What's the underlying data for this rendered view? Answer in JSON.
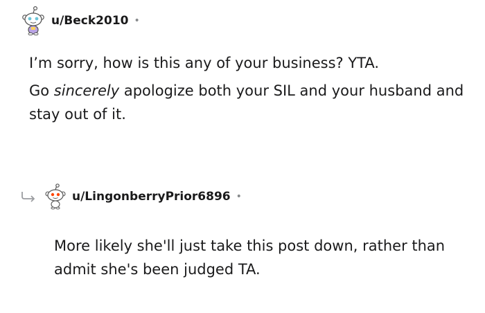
{
  "comments": [
    {
      "username": "u/Beck2010",
      "avatar_icon": "snoo-avatar-icon",
      "separator": "•",
      "paragraphs": [
        "I’m sorry, how is this any of your business? YTA."
      ],
      "para2_before": "Go ",
      "para2_em": "sincerely",
      "para2_after": " apologize both your SIL and your husband and stay out of it."
    },
    {
      "username": "u/LingonberryPrior6896",
      "avatar_icon": "snoo-avatar-icon",
      "reply_icon": "reply-arrow-icon",
      "separator": "•",
      "text": "More likely she'll just take this post down, rather than admit she's been judged TA."
    }
  ],
  "colors": {
    "text": "#1a1a1b",
    "meta": "#878a8c",
    "accent": "#ff4500"
  }
}
